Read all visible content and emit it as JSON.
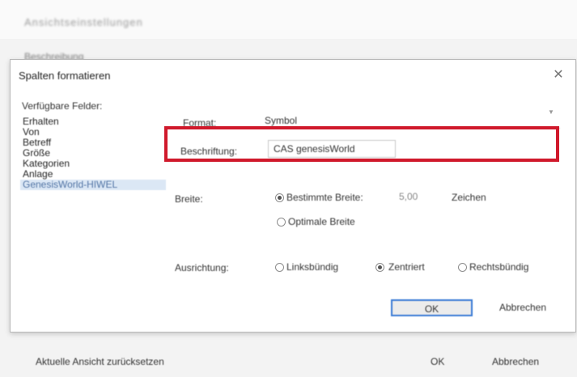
{
  "background": {
    "window_title": "Ansichtseinstellungen",
    "section_label": "Beschreibung",
    "reset_label": "Aktuelle Ansicht zurücksetzen",
    "ok_label": "OK",
    "cancel_label": "Abbrechen"
  },
  "dialog": {
    "title": "Spalten formatieren",
    "close_glyph": "✕",
    "fields_heading": "Verfügbare Felder:",
    "fields": [
      "Erhalten",
      "Von",
      "Betreff",
      "Größe",
      "Kategorien",
      "Anlage",
      "GenesisWorld-HIWEL"
    ],
    "selected_field_index": 6,
    "format_label": "Format:",
    "format_value": "Symbol",
    "caption_label": "Beschriftung:",
    "caption_value": "CAS genesisWorld",
    "width_label": "Breite:",
    "width_option_best": "Bestimmte Breite:",
    "width_value": "5,00",
    "width_unit": "Zeichen",
    "width_option_optimal": "Optimale Breite",
    "width_selected": "best",
    "align_label": "Ausrichtung:",
    "align_left": "Linksbündig",
    "align_center": "Zentriert",
    "align_right": "Rechtsbündig",
    "align_selected": "center",
    "ok_label": "OK",
    "cancel_label": "Abbrechen",
    "highlight_color": "#d0192b"
  }
}
